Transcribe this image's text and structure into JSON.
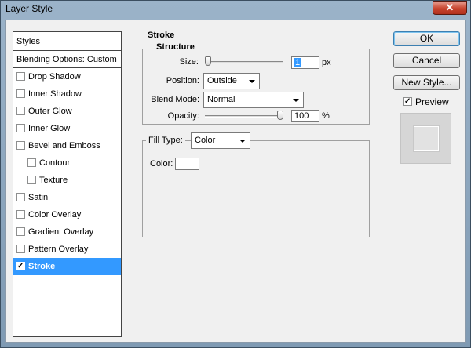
{
  "window": {
    "title": "Layer Style",
    "close_glyph": "✕"
  },
  "styles": {
    "header": "Styles",
    "blending": "Blending Options: Custom",
    "items": [
      {
        "label": "Drop Shadow",
        "checked": false,
        "sub": false
      },
      {
        "label": "Inner Shadow",
        "checked": false,
        "sub": false
      },
      {
        "label": "Outer Glow",
        "checked": false,
        "sub": false
      },
      {
        "label": "Inner Glow",
        "checked": false,
        "sub": false
      },
      {
        "label": "Bevel and Emboss",
        "checked": false,
        "sub": false
      },
      {
        "label": "Contour",
        "checked": false,
        "sub": true
      },
      {
        "label": "Texture",
        "checked": false,
        "sub": true
      },
      {
        "label": "Satin",
        "checked": false,
        "sub": false
      },
      {
        "label": "Color Overlay",
        "checked": false,
        "sub": false
      },
      {
        "label": "Gradient Overlay",
        "checked": false,
        "sub": false
      },
      {
        "label": "Pattern Overlay",
        "checked": false,
        "sub": false
      },
      {
        "label": "Stroke",
        "checked": true,
        "sub": false,
        "selected": true
      }
    ]
  },
  "stroke": {
    "title": "Stroke",
    "structure": "Structure",
    "size_label": "Size:",
    "size_value": "1",
    "size_unit": "px",
    "size_level": 0.0,
    "position_label": "Position:",
    "position_value": "Outside",
    "blend_label": "Blend Mode:",
    "blend_value": "Normal",
    "opacity_label": "Opacity:",
    "opacity_value": "100",
    "opacity_unit": "%",
    "opacity_level": 1.0,
    "fill_type_label": "Fill Type:",
    "fill_type_value": "Color",
    "color_label": "Color:",
    "color_hex": "#ffffff"
  },
  "buttons": {
    "ok": "OK",
    "cancel": "Cancel",
    "new_style": "New Style...",
    "preview_label": "Preview",
    "preview_checked": true
  }
}
